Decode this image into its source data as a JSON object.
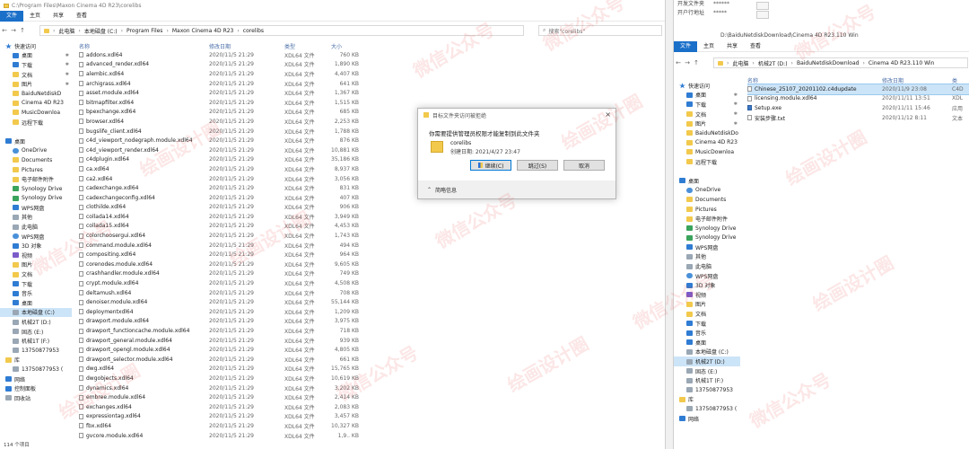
{
  "left_window": {
    "title": "C:\\Program Files\\Maxon Cinema 4D R23\\corelibs",
    "ribbon_tabs": [
      "文件",
      "主页",
      "共享",
      "查看"
    ],
    "breadcrumbs": [
      "此电脑",
      "本地磁盘 (C:)",
      "Program Files",
      "Maxon Cinema 4D R23",
      "corelibs"
    ],
    "search_placeholder": "搜索\"corelibs\"",
    "columns": {
      "name": "名称",
      "date": "修改日期",
      "type": "类型",
      "size": "大小"
    },
    "nav": [
      {
        "label": "快速访问",
        "icon": "star",
        "pin": false,
        "sel": false
      },
      {
        "label": "桌面",
        "icon": "blue",
        "pin": true,
        "sel": false
      },
      {
        "label": "下载",
        "icon": "blue",
        "pin": true,
        "sel": false
      },
      {
        "label": "文档",
        "icon": "folder",
        "pin": true,
        "sel": false
      },
      {
        "label": "图片",
        "icon": "folder",
        "pin": true,
        "sel": false
      },
      {
        "label": "BaiduNetdiskD",
        "icon": "folder",
        "pin": false,
        "sel": false
      },
      {
        "label": "Cinema 4D R23",
        "icon": "folder",
        "pin": false,
        "sel": false
      },
      {
        "label": "MusicDownloa",
        "icon": "folder",
        "pin": false,
        "sel": false
      },
      {
        "label": "远程下载",
        "icon": "folder",
        "pin": false,
        "sel": false
      },
      {
        "label": "",
        "icon": "",
        "pin": false,
        "sel": false
      },
      {
        "label": "桌面",
        "icon": "blue",
        "pin": false,
        "sel": false
      },
      {
        "label": "OneDrive",
        "icon": "cloud",
        "pin": false,
        "sel": false
      },
      {
        "label": "Documents",
        "icon": "folder",
        "pin": false,
        "sel": false
      },
      {
        "label": "Pictures",
        "icon": "folder",
        "pin": false,
        "sel": false
      },
      {
        "label": "电子邮件附件",
        "icon": "folder",
        "pin": false,
        "sel": false
      },
      {
        "label": "Synology Drive",
        "icon": "green",
        "pin": false,
        "sel": false
      },
      {
        "label": "Synology Drive",
        "icon": "green",
        "pin": false,
        "sel": false
      },
      {
        "label": "WPS网盘",
        "icon": "blue",
        "pin": false,
        "sel": false
      },
      {
        "label": "其他",
        "icon": "drive",
        "pin": false,
        "sel": false
      },
      {
        "label": "此电脑",
        "icon": "drive",
        "pin": false,
        "sel": false
      },
      {
        "label": "WPS网盘",
        "icon": "cloud",
        "pin": false,
        "sel": false
      },
      {
        "label": "3D 对象",
        "icon": "blue",
        "pin": false,
        "sel": false
      },
      {
        "label": "视频",
        "icon": "purple",
        "pin": false,
        "sel": false
      },
      {
        "label": "图片",
        "icon": "folder",
        "pin": false,
        "sel": false
      },
      {
        "label": "文档",
        "icon": "folder",
        "pin": false,
        "sel": false
      },
      {
        "label": "下载",
        "icon": "blue",
        "pin": false,
        "sel": false
      },
      {
        "label": "音乐",
        "icon": "blue",
        "pin": false,
        "sel": false
      },
      {
        "label": "桌面",
        "icon": "blue",
        "pin": false,
        "sel": false
      },
      {
        "label": "本地磁盘 (C:)",
        "icon": "drive",
        "pin": false,
        "sel": true
      },
      {
        "label": "机械2T (D:)",
        "icon": "drive",
        "pin": false,
        "sel": false
      },
      {
        "label": "固态 (E:)",
        "icon": "drive",
        "pin": false,
        "sel": false
      },
      {
        "label": "机械1T (F:)",
        "icon": "drive",
        "pin": false,
        "sel": false
      },
      {
        "label": "13750877953",
        "icon": "drive",
        "pin": false,
        "sel": false
      },
      {
        "label": "库",
        "icon": "folder",
        "pin": false,
        "sel": false
      },
      {
        "label": "13750877953 (",
        "icon": "drive",
        "pin": false,
        "sel": false
      },
      {
        "label": "网络",
        "icon": "blue",
        "pin": false,
        "sel": false
      },
      {
        "label": "控制面板",
        "icon": "blue",
        "pin": false,
        "sel": false
      },
      {
        "label": "回收站",
        "icon": "drive",
        "pin": false,
        "sel": false
      }
    ],
    "files": [
      {
        "name": "addons.xdl64",
        "date": "2020/11/5 21:29",
        "type": "XDL64 文件",
        "size": "760 KB"
      },
      {
        "name": "advanced_render.xdl64",
        "date": "2020/11/5 21:29",
        "type": "XDL64 文件",
        "size": "1,890 KB"
      },
      {
        "name": "alembic.xdl64",
        "date": "2020/11/5 21:29",
        "type": "XDL64 文件",
        "size": "4,407 KB"
      },
      {
        "name": "archigrass.xdl64",
        "date": "2020/11/5 21:29",
        "type": "XDL64 文件",
        "size": "641 KB"
      },
      {
        "name": "asset.module.xdl64",
        "date": "2020/11/5 21:29",
        "type": "XDL64 文件",
        "size": "1,367 KB"
      },
      {
        "name": "bitmapfilter.xdl64",
        "date": "2020/11/5 21:29",
        "type": "XDL64 文件",
        "size": "1,515 KB"
      },
      {
        "name": "bpexchange.xdl64",
        "date": "2020/11/5 21:29",
        "type": "XDL64 文件",
        "size": "685 KB"
      },
      {
        "name": "browser.xdl64",
        "date": "2020/11/5 21:29",
        "type": "XDL64 文件",
        "size": "2,253 KB"
      },
      {
        "name": "bugslife_client.xdl64",
        "date": "2020/11/5 21:29",
        "type": "XDL64 文件",
        "size": "1,788 KB"
      },
      {
        "name": "c4d_viewport_nodegraph.module.xdl64",
        "date": "2020/11/5 21:29",
        "type": "XDL64 文件",
        "size": "876 KB"
      },
      {
        "name": "c4d_viewport_render.xdl64",
        "date": "2020/11/5 21:29",
        "type": "XDL64 文件",
        "size": "10,881 KB"
      },
      {
        "name": "c4dplugin.xdl64",
        "date": "2020/11/5 21:29",
        "type": "XDL64 文件",
        "size": "35,186 KB"
      },
      {
        "name": "ca.xdl64",
        "date": "2020/11/5 21:29",
        "type": "XDL64 文件",
        "size": "8,937 KB"
      },
      {
        "name": "ca2.xdl64",
        "date": "2020/11/5 21:29",
        "type": "XDL64 文件",
        "size": "3,056 KB"
      },
      {
        "name": "cadexchange.xdl64",
        "date": "2020/11/5 21:29",
        "type": "XDL64 文件",
        "size": "831 KB"
      },
      {
        "name": "cadexchangeconfig.xdl64",
        "date": "2020/11/5 21:29",
        "type": "XDL64 文件",
        "size": "407 KB"
      },
      {
        "name": "clothilde.xdl64",
        "date": "2020/11/5 21:29",
        "type": "XDL64 文件",
        "size": "906 KB"
      },
      {
        "name": "collada14.xdl64",
        "date": "2020/11/5 21:29",
        "type": "XDL64 文件",
        "size": "3,949 KB"
      },
      {
        "name": "collada15.xdl64",
        "date": "2020/11/5 21:29",
        "type": "XDL64 文件",
        "size": "4,453 KB"
      },
      {
        "name": "colorchoosergui.xdl64",
        "date": "2020/11/5 21:29",
        "type": "XDL64 文件",
        "size": "1,743 KB"
      },
      {
        "name": "command.module.xdl64",
        "date": "2020/11/5 21:29",
        "type": "XDL64 文件",
        "size": "494 KB"
      },
      {
        "name": "compositing.xdl64",
        "date": "2020/11/5 21:29",
        "type": "XDL64 文件",
        "size": "964 KB"
      },
      {
        "name": "corenodes.module.xdl64",
        "date": "2020/11/5 21:29",
        "type": "XDL64 文件",
        "size": "9,605 KB"
      },
      {
        "name": "crashhandler.module.xdl64",
        "date": "2020/11/5 21:29",
        "type": "XDL64 文件",
        "size": "749 KB"
      },
      {
        "name": "crypt.module.xdl64",
        "date": "2020/11/5 21:29",
        "type": "XDL64 文件",
        "size": "4,508 KB"
      },
      {
        "name": "deltamush.xdl64",
        "date": "2020/11/5 21:29",
        "type": "XDL64 文件",
        "size": "708 KB"
      },
      {
        "name": "denoiser.module.xdl64",
        "date": "2020/11/5 21:29",
        "type": "XDL64 文件",
        "size": "55,144 KB"
      },
      {
        "name": "deploymentxdl64",
        "date": "2020/11/5 21:29",
        "type": "XDL64 文件",
        "size": "1,209 KB"
      },
      {
        "name": "drawport.module.xdl64",
        "date": "2020/11/5 21:29",
        "type": "XDL64 文件",
        "size": "3,975 KB"
      },
      {
        "name": "drawport_functioncache.module.xdl64",
        "date": "2020/11/5 21:29",
        "type": "XDL64 文件",
        "size": "718 KB"
      },
      {
        "name": "drawport_general.module.xdl64",
        "date": "2020/11/5 21:29",
        "type": "XDL64 文件",
        "size": "939 KB"
      },
      {
        "name": "drawport_opengl.module.xdl64",
        "date": "2020/11/5 21:29",
        "type": "XDL64 文件",
        "size": "4,805 KB"
      },
      {
        "name": "drawport_selector.module.xdl64",
        "date": "2020/11/5 21:29",
        "type": "XDL64 文件",
        "size": "661 KB"
      },
      {
        "name": "dwg.xdl64",
        "date": "2020/11/5 21:29",
        "type": "XDL64 文件",
        "size": "15,765 KB"
      },
      {
        "name": "dwgobjects.xdl64",
        "date": "2020/11/5 21:29",
        "type": "XDL64 文件",
        "size": "10,619 KB"
      },
      {
        "name": "dynamics.xdl64",
        "date": "2020/11/5 21:29",
        "type": "XDL64 文件",
        "size": "3,202 KB"
      },
      {
        "name": "embree.module.xdl64",
        "date": "2020/11/5 21:29",
        "type": "XDL64 文件",
        "size": "2,414 KB"
      },
      {
        "name": "exchanges.xdl64",
        "date": "2020/11/5 21:29",
        "type": "XDL64 文件",
        "size": "2,083 KB"
      },
      {
        "name": "expressiontag.xdl64",
        "date": "2020/11/5 21:29",
        "type": "XDL64 文件",
        "size": "3,457 KB"
      },
      {
        "name": "fbx.xdl64",
        "date": "2020/11/5 21:29",
        "type": "XDL64 文件",
        "size": "10,327 KB"
      },
      {
        "name": "gvcore.module.xdl64",
        "date": "2020/11/5 21:29",
        "type": "XDL64 文件",
        "size": "1,9.. KB"
      }
    ],
    "status": "114 个项目"
  },
  "dialog": {
    "title": "目标文件夹访问被拒绝",
    "message": "你需要提供管理员权限才能复制到此文件夹",
    "folder_name": "corelibs",
    "folder_date": "创建日期: 2021/4/27 23:47",
    "buttons": {
      "continue": "继续(C)",
      "skip": "跳过(S)",
      "cancel": "取消"
    },
    "details": "简略信息"
  },
  "right_window": {
    "title": "D:\\BaiduNetdiskDownload\\Cinema 4D R23.110 Win",
    "ribbon_tabs": [
      "文件",
      "主页",
      "共享",
      "查看"
    ],
    "breadcrumbs": [
      "此电脑",
      "机械2T (D:)",
      "BaiduNetdiskDownload",
      "Cinema 4D R23.110 Win"
    ],
    "columns": {
      "name": "名称",
      "date": "修改日期",
      "type": "类"
    },
    "nav": [
      {
        "label": "快速访问",
        "icon": "star",
        "pin": false,
        "sel": false
      },
      {
        "label": "桌面",
        "icon": "blue",
        "pin": true,
        "sel": false
      },
      {
        "label": "下载",
        "icon": "blue",
        "pin": true,
        "sel": false
      },
      {
        "label": "文档",
        "icon": "folder",
        "pin": true,
        "sel": false
      },
      {
        "label": "图片",
        "icon": "folder",
        "pin": true,
        "sel": false
      },
      {
        "label": "BaiduNetdiskDo",
        "icon": "folder",
        "pin": false,
        "sel": false
      },
      {
        "label": "Cinema 4D R23",
        "icon": "folder",
        "pin": false,
        "sel": false
      },
      {
        "label": "MusicDownloa",
        "icon": "folder",
        "pin": false,
        "sel": false
      },
      {
        "label": "远程下载",
        "icon": "folder",
        "pin": false,
        "sel": false
      },
      {
        "label": "",
        "icon": "",
        "pin": false,
        "sel": false
      },
      {
        "label": "桌面",
        "icon": "blue",
        "pin": false,
        "sel": false
      },
      {
        "label": "OneDrive",
        "icon": "cloud",
        "pin": false,
        "sel": false
      },
      {
        "label": "Documents",
        "icon": "folder",
        "pin": false,
        "sel": false
      },
      {
        "label": "Pictures",
        "icon": "folder",
        "pin": false,
        "sel": false
      },
      {
        "label": "电子邮件附件",
        "icon": "folder",
        "pin": false,
        "sel": false
      },
      {
        "label": "Synology Drive",
        "icon": "green",
        "pin": false,
        "sel": false
      },
      {
        "label": "Synology Drive",
        "icon": "green",
        "pin": false,
        "sel": false
      },
      {
        "label": "WPS网盘",
        "icon": "blue",
        "pin": false,
        "sel": false
      },
      {
        "label": "其他",
        "icon": "drive",
        "pin": false,
        "sel": false
      },
      {
        "label": "此电脑",
        "icon": "drive",
        "pin": false,
        "sel": false
      },
      {
        "label": "WPS网盘",
        "icon": "cloud",
        "pin": false,
        "sel": false
      },
      {
        "label": "3D 对象",
        "icon": "blue",
        "pin": false,
        "sel": false
      },
      {
        "label": "视频",
        "icon": "purple",
        "pin": false,
        "sel": false
      },
      {
        "label": "图片",
        "icon": "folder",
        "pin": false,
        "sel": false
      },
      {
        "label": "文档",
        "icon": "folder",
        "pin": false,
        "sel": false
      },
      {
        "label": "下载",
        "icon": "blue",
        "pin": false,
        "sel": false
      },
      {
        "label": "音乐",
        "icon": "blue",
        "pin": false,
        "sel": false
      },
      {
        "label": "桌面",
        "icon": "blue",
        "pin": false,
        "sel": false
      },
      {
        "label": "本地磁盘 (C:)",
        "icon": "drive",
        "pin": false,
        "sel": false
      },
      {
        "label": "机械2T (D:)",
        "icon": "drive",
        "pin": false,
        "sel": true
      },
      {
        "label": "固态 (E:)",
        "icon": "drive",
        "pin": false,
        "sel": false
      },
      {
        "label": "机械1T (F:)",
        "icon": "drive",
        "pin": false,
        "sel": false
      },
      {
        "label": "13750877953",
        "icon": "drive",
        "pin": false,
        "sel": false
      },
      {
        "label": "库",
        "icon": "folder",
        "pin": false,
        "sel": false
      },
      {
        "label": "13750877953 (",
        "icon": "drive",
        "pin": false,
        "sel": false
      },
      {
        "label": "网络",
        "icon": "blue",
        "pin": false,
        "sel": false
      }
    ],
    "files": [
      {
        "name": "Chinese_25107_20201102.c4dupdate",
        "date": "2020/11/9 23:08",
        "type": "C4D",
        "icon": "file",
        "sel": true
      },
      {
        "name": "licensing.module.xdl64",
        "date": "2020/11/11 13:51",
        "type": "XDL",
        "icon": "file",
        "sel": false
      },
      {
        "name": "Setup.exe",
        "date": "2020/11/11 15:46",
        "type": "应用",
        "icon": "exe",
        "sel": false
      },
      {
        "name": "安装步骤.txt",
        "date": "2020/11/12 8:11",
        "type": "文本",
        "icon": "txt",
        "sel": false
      }
    ]
  },
  "info_panel": {
    "row1_label": "开发文件夹",
    "row1_value": "******",
    "row2_label": "开户行地址",
    "row2_value": "*****"
  },
  "watermark": {
    "text1": "微信公众号",
    "text2": "绘画设计圈"
  }
}
